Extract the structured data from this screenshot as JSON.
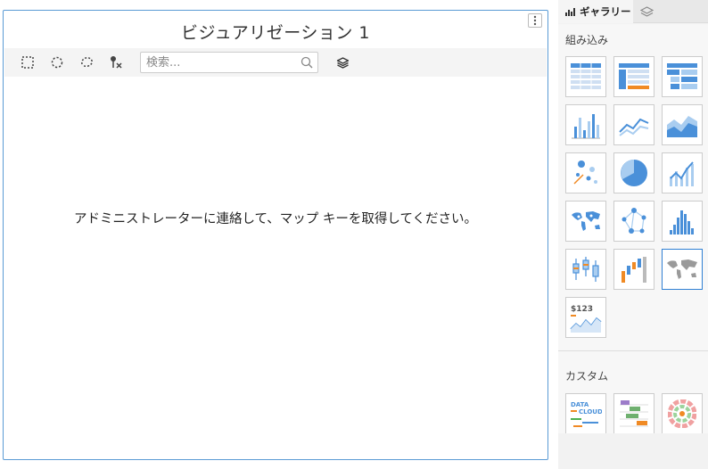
{
  "visualization": {
    "title": "ビジュアリゼーション 1",
    "message": "アドミニストレーターに連絡して、マップ キーを取得してください。",
    "menu_icon": "more-vertical-icon",
    "search": {
      "placeholder": "検索..."
    },
    "toolbar": [
      "rect-select-icon",
      "circle-select-icon",
      "lasso-select-icon",
      "clear-pins-icon",
      "layers-icon"
    ]
  },
  "sidebar": {
    "tabs": [
      {
        "label": "ギャラリー",
        "icon": "bar-chart-icon"
      },
      {
        "label": "",
        "icon": "layers-icon"
      }
    ],
    "builtin_label": "組み込み",
    "custom_label": "カスタム",
    "builtin_tiles": [
      "table",
      "pivot-table",
      "tree-table",
      "bar-chart",
      "line-chart",
      "area-chart",
      "scatter-plot",
      "pie-chart",
      "combo-chart",
      "point-map",
      "network",
      "histogram",
      "box-plot",
      "waterfall",
      "choropleth-map",
      "kpi"
    ],
    "selected_tile": "choropleth-map",
    "kpi_text": "$123",
    "custom_tiles": [
      "word-cloud",
      "gantt",
      "sunburst"
    ],
    "word_cloud_text": [
      "DATA",
      "CLOUD"
    ]
  },
  "colors": {
    "accent": "#2f7fd3",
    "blue": "#4a90d9",
    "light_blue": "#a9cdf0",
    "orange": "#f08a24",
    "gray": "#9a9a9a"
  }
}
